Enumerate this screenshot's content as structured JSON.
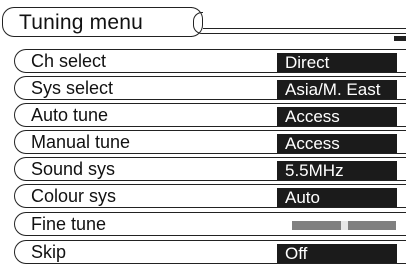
{
  "menu": {
    "title": "Tuning menu",
    "items": [
      {
        "label": "Ch select",
        "value": "Direct"
      },
      {
        "label": "Sys select",
        "value": "Asia/M. East"
      },
      {
        "label": "Auto tune",
        "value": "Access"
      },
      {
        "label": "Manual tune",
        "value": "Access"
      },
      {
        "label": "Sound sys",
        "value": "5.5MHz"
      },
      {
        "label": "Colour sys",
        "value": "Auto"
      },
      {
        "label": "Fine tune",
        "value": null,
        "slider_level": 0.5
      },
      {
        "label": "Skip",
        "value": "Off"
      }
    ]
  }
}
